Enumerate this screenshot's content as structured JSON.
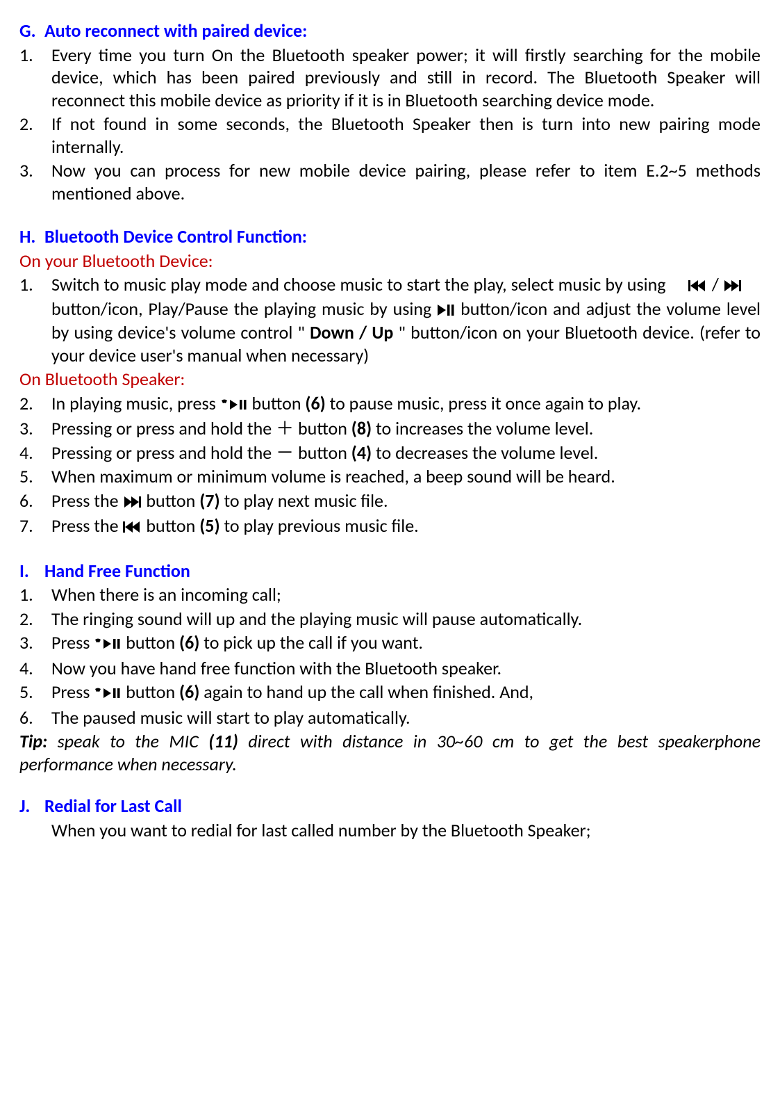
{
  "G": {
    "prefix": "G.",
    "title": "Auto reconnect with paired device:",
    "items": [
      {
        "num": "1.",
        "text": "Every time you turn On the Bluetooth speaker power; it will firstly searching for the mobile device, which has been paired previously and still in record. The Bluetooth Speaker will reconnect this mobile device as priority if it is in Bluetooth searching device mode."
      },
      {
        "num": "2.",
        "text": "If not found in some seconds, the Bluetooth Speaker then is turn into new pairing mode internally."
      },
      {
        "num": "3.",
        "text": "Now you can process for new mobile device pairing, please refer to item E.2~5 methods mentioned above."
      }
    ]
  },
  "H": {
    "prefix": "H.",
    "title": "Bluetooth Device Control Function:",
    "sub1": "On your Bluetooth Device:",
    "sub2": "On Bluetooth Speaker:",
    "item1": {
      "num": "1.",
      "t1": "Switch to music play mode and choose music to start the play, select music by using  ",
      "slash": " / ",
      "t2": " button/icon, Play/Pause the playing music by using ",
      "t3": " button/icon and adjust the volume level by using device's volume control \" ",
      "down_up": "Down / Up",
      "t4": " \" button/icon on your Bluetooth device. (refer to your device user's manual when necessary)"
    },
    "item2": {
      "num": "2.",
      "t1": "In playing music, press ",
      "t2": " button ",
      "ref": "(6)",
      "t3": " to pause music, press it once again to play."
    },
    "item3": {
      "num": "3.",
      "t1": "Pressing or press and hold the ",
      "plus": "＋",
      "t2": " button ",
      "ref": "(8)",
      "t3": " to increases the volume level."
    },
    "item4": {
      "num": "4.",
      "t1": "Pressing or press and hold the ",
      "minus": "－",
      "t2": " button ",
      "ref": "(4)",
      "t3": " to decreases the volume level."
    },
    "item5": {
      "num": "5.",
      "text": "When maximum or minimum volume is reached, a beep sound will be heard."
    },
    "item6": {
      "num": "6.",
      "t1": "Press the ",
      "t2": " button ",
      "ref": "(7)",
      "t3": " to play next music file."
    },
    "item7": {
      "num": "7.",
      "t1": "Press the ",
      "t2": " button ",
      "ref": "(5)",
      "t3": " to play previous music file."
    }
  },
  "I": {
    "prefix": "I.",
    "title": "Hand Free Function",
    "item1": {
      "num": "1.",
      "text": "When there is an incoming call;"
    },
    "item2": {
      "num": "2.",
      "text": "The ringing sound will up and the playing music will pause automatically."
    },
    "item3": {
      "num": "3.",
      "t1": "Press ",
      "t2": " button ",
      "ref": "(6)",
      "t3": " to pick up the call if you want."
    },
    "item4": {
      "num": "4.",
      "text": "Now you have hand free function with the Bluetooth speaker."
    },
    "item5": {
      "num": "5.",
      "t1": "Press ",
      "t2": " button ",
      "ref": "(6)",
      "t3": " again to hand up the call when finished. And,"
    },
    "item6": {
      "num": "6.",
      "text": "The paused music will start to play automatically."
    },
    "tip": {
      "label": "Tip:",
      "t1": " speak to the MIC ",
      "ref": "(11)",
      "t2": " direct with distance in 30~60 cm to get the best speakerphone performance when necessary."
    }
  },
  "J": {
    "prefix": "J.",
    "title": "Redial for Last Call",
    "body": "When you want to redial for last called number by the Bluetooth Speaker;"
  }
}
